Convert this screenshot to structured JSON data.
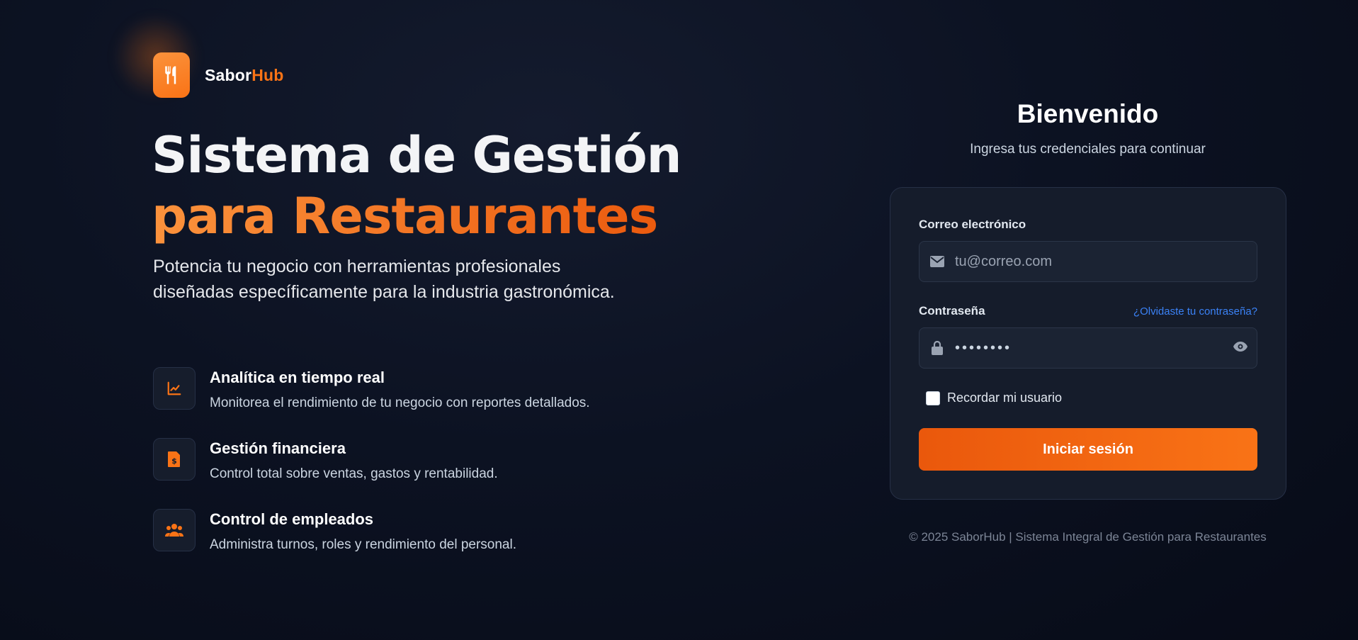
{
  "brand": {
    "name_part1": "Sabor",
    "name_part2": "Hub"
  },
  "hero": {
    "title_line1": "Sistema de Gestión",
    "title_line2": "para Restaurantes",
    "lead": "Potencia tu negocio con herramientas profesionales diseñadas específicamente para la industria gastronómica."
  },
  "features": [
    {
      "icon": "chart-line-icon",
      "title": "Analítica en tiempo real",
      "desc": "Monitorea el rendimiento de tu negocio con reportes detallados."
    },
    {
      "icon": "invoice-dollar-icon",
      "title": "Gestión financiera",
      "desc": "Control total sobre ventas, gastos y rentabilidad."
    },
    {
      "icon": "users-icon",
      "title": "Control de empleados",
      "desc": "Administra turnos, roles y rendimiento del personal."
    }
  ],
  "login": {
    "title": "Bienvenido",
    "subtitle": "Ingresa tus credenciales para continuar",
    "email_label": "Correo electrónico",
    "email_placeholder": "tu@correo.com",
    "email_value": "",
    "password_label": "Contraseña",
    "password_value": "••••••••",
    "forgot_link": "¿Olvidaste tu contraseña?",
    "remember_label": "Recordar mi usuario",
    "remember_checked": false,
    "submit_label": "Iniciar sesión"
  },
  "footer": {
    "text": "© 2025 SaborHub | Sistema Integral de Gestión para Restaurantes"
  },
  "colors": {
    "accent": "#f97316",
    "link": "#3b82f6",
    "background": "#0c1222",
    "card": "#151c2b"
  }
}
